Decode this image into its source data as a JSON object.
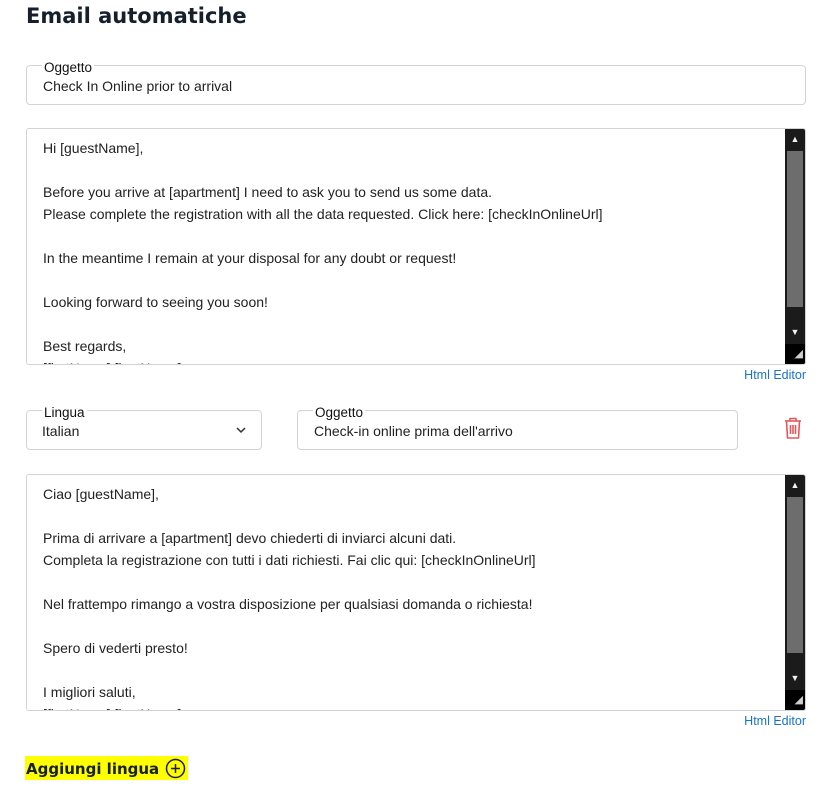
{
  "page": {
    "title": "Email automatiche"
  },
  "default_email": {
    "subject_label": "Oggetto",
    "subject_value": "Check In Online prior to arrival",
    "body": "Hi [guestName],\n\nBefore you arrive at [apartment] I need to ask you to send us some data.\nPlease complete the registration with all the data requested. Click here: [checkInOnlineUrl]\n\nIn the meantime I remain at your disposal for any doubt or request!\n\nLooking forward to seeing you soon!\n\nBest regards,\n[firstName] [lastName]",
    "html_editor_label": "Html Editor"
  },
  "translation": {
    "language_label": "Lingua",
    "language_value": "Italian",
    "subject_label": "Oggetto",
    "subject_value": "Check-in online prima dell'arrivo",
    "body": "Ciao [guestName],\n\nPrima di arrivare a [apartment] devo chiederti di inviarci alcuni dati.\nCompleta la registrazione con tutti i dati richiesti. Fai clic qui: [checkInOnlineUrl]\n\nNel frattempo rimango a vostra disposizione per qualsiasi domanda o richiesta!\n\nSpero di vederti presto!\n\nI migliori saluti,\n[firstName] [lastName]",
    "html_editor_label": "Html Editor",
    "delete_icon": "trash-icon"
  },
  "add_language": {
    "label": "Aggiungi lingua",
    "icon": "plus-circle-icon"
  },
  "colors": {
    "link": "#1a73c9",
    "danger": "#e2585a",
    "highlight": "#ffff00",
    "title": "#16202c"
  }
}
